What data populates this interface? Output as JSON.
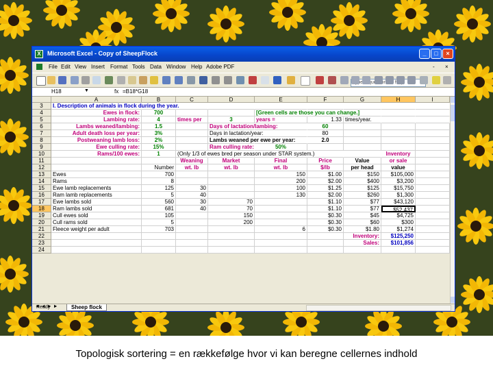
{
  "window": {
    "title": "Microsoft Excel - Copy of SheepFlock",
    "minimize": "_",
    "maximize": "□",
    "close": "×",
    "app_icon": "X"
  },
  "menu": {
    "items": [
      "File",
      "Edit",
      "View",
      "Insert",
      "Format",
      "Tools",
      "Data",
      "Window",
      "Help",
      "Adobe PDF"
    ],
    "help_placeholder": "Type a question for help",
    "minimize": "-",
    "close": "×"
  },
  "formula_bar": {
    "name_box": "H18",
    "fx": "fx",
    "formula": "=B18*G18"
  },
  "columns": [
    "A",
    "B",
    "C",
    "D",
    "E",
    "F",
    "G",
    "H",
    "I"
  ],
  "rows": [
    "3",
    "4",
    "5",
    "6",
    "7",
    "8",
    "9",
    "10",
    "11",
    "12",
    "13",
    "14",
    "15",
    "16",
    "17",
    "18",
    "19",
    "20",
    "21",
    "22",
    "23",
    "24"
  ],
  "cells": {
    "r3_a": "I. Description of animals in flock during the year.",
    "r4_a": "Ewes in flock:",
    "r4_b": "700",
    "r4_e": "[Green cells are those you can change.]",
    "r5_a": "Lambing rate:",
    "r5_b": "4",
    "r5_c": "times per",
    "r5_d": "3",
    "r5_e": "years =",
    "r5_f": "1.33",
    "r5_g": "times/year.",
    "r6_a": "Lambs weaned/lambing:",
    "r6_b": "1.5",
    "r6_d": "Days of lactation/lambing:",
    "r6_f": "60",
    "r7_a": "Adult death loss per year:",
    "r7_b": "3%",
    "r7_d": "Days in lactation/year:",
    "r7_f": "80",
    "r8_a": "Postweaning lamb loss:",
    "r8_b": "2%",
    "r8_d": "Lambs weaned per ewe per year:",
    "r8_f": "2.0",
    "r9_a": "Ewe culling rate:",
    "r9_b": "15%",
    "r9_d": "Ram culling rate:",
    "r9_e": "50%",
    "r10_a": "Rams/100 ewes:",
    "r10_b": "1",
    "r10_c": "(Only 1/3 of ewes bred per season under STAR system.)",
    "r10_h": "Inventory",
    "r11_c": "Weaning",
    "r11_d": "Market",
    "r11_e": "Final",
    "r11_f": "Price",
    "r11_g": "Value",
    "r11_h": "or sale",
    "r12_b": "Number",
    "r12_c": "wt. lb",
    "r12_d": "wt. lb",
    "r12_e": "wt. lb",
    "r12_f": "$/lb",
    "r12_g": "per head",
    "r12_h": "value",
    "r13_a": "Ewes",
    "r13_b": "700",
    "r13_e": "150",
    "r13_f": "$1.00",
    "r13_g": "$150",
    "r13_h": "$105,000",
    "r14_a": "Rams",
    "r14_b": "8",
    "r14_e": "200",
    "r14_f": "$2.00",
    "r14_g": "$400",
    "r14_h": "$3,200",
    "r15_a": "Ewe lamb replacements",
    "r15_b": "125",
    "r15_c": "30",
    "r15_e": "100",
    "r15_f": "$1.25",
    "r15_g": "$125",
    "r15_h": "$15,750",
    "r16_a": "Ram lamb replacements",
    "r16_b": "5",
    "r16_c": "40",
    "r16_e": "130",
    "r16_f": "$2.00",
    "r16_g": "$260",
    "r16_h": "$1,300",
    "r17_a": "Ewe lambs sold",
    "r17_b": "560",
    "r17_c": "30",
    "r17_d": "70",
    "r17_f": "$1.10",
    "r17_g": "$77",
    "r17_h": "$43,120",
    "r18_a": "Ram lambs sold",
    "r18_b": "681",
    "r18_c": "40",
    "r18_d": "70",
    "r18_f": "$1.10",
    "r18_g": "$77",
    "r18_h": "$52,437",
    "r19_a": "Cull ewes sold",
    "r19_b": "105",
    "r19_d": "150",
    "r19_f": "$0.30",
    "r19_g": "$45",
    "r19_h": "$4,725",
    "r20_a": "Cull rams sold",
    "r20_b": "5",
    "r20_d": "200",
    "r20_f": "$0.30",
    "r20_g": "$60",
    "r20_h": "$300",
    "r21_a": "Fleece weight per adult",
    "r21_b": "703",
    "r21_e": "6",
    "r21_f": "$0.30",
    "r21_g": "$1.80",
    "r21_h": "$1,274",
    "r22_g": "Inventory:",
    "r22_h": "$125,250",
    "r23_g": "Sales:",
    "r23_h": "$101,856"
  },
  "sheet_tab": "Sheep flock",
  "status": "Ready",
  "caption": "Topologisk sortering  =  en rækkefølge hvor vi kan beregne cellernes indhold",
  "colors": {
    "title_bar": "#0a5fe8",
    "label_pink": "#c0007a",
    "input_green": "#008000",
    "caption_bg": "#ffffff"
  }
}
